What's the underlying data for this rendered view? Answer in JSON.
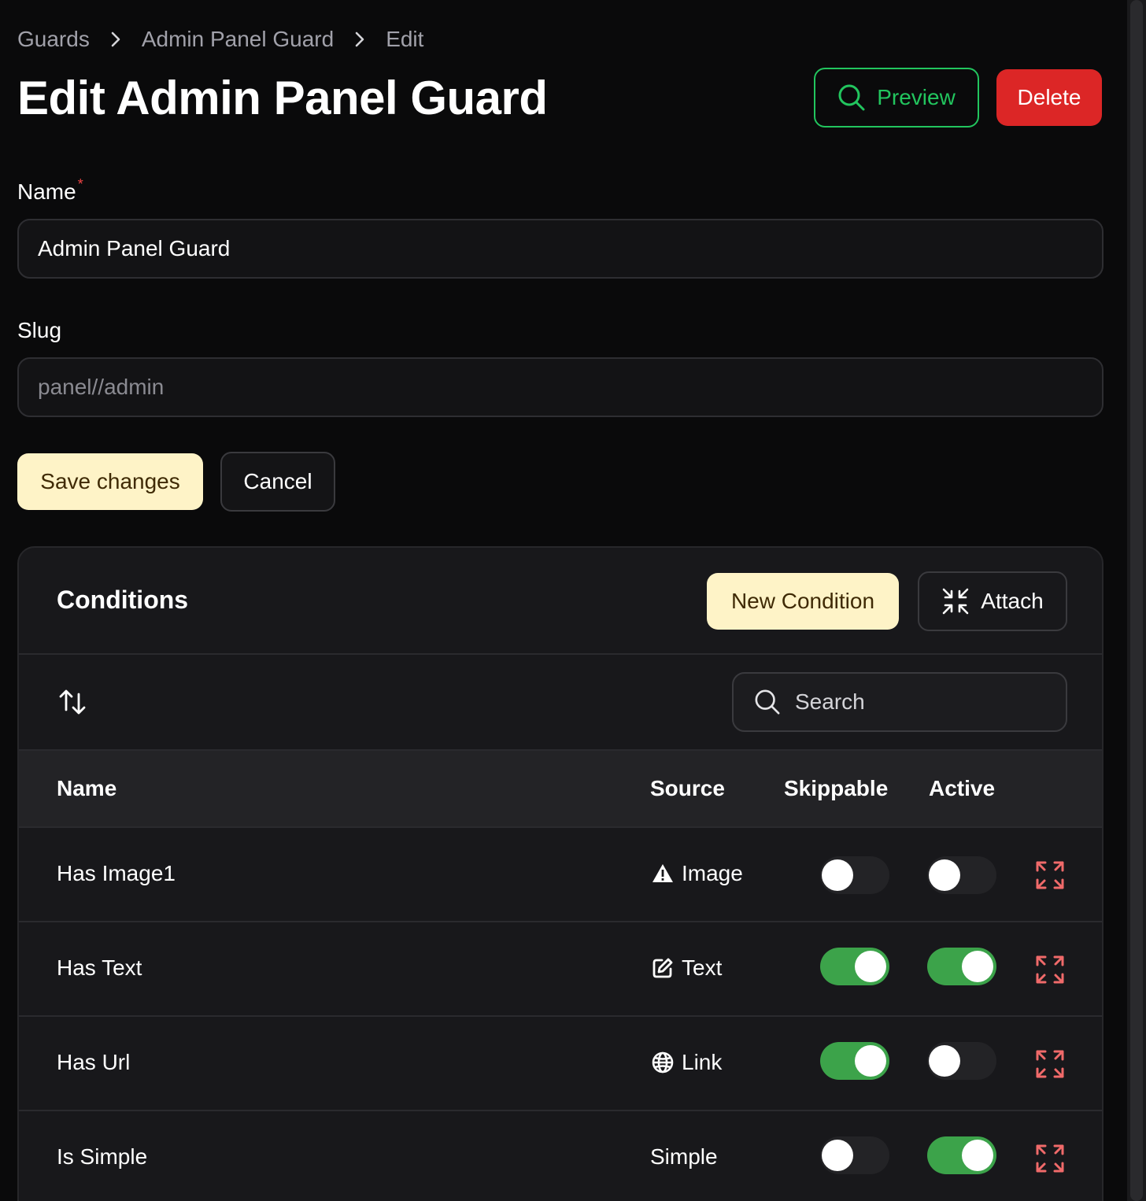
{
  "breadcrumb": [
    "Guards",
    "Admin Panel Guard",
    "Edit"
  ],
  "page_title": "Edit Admin Panel Guard",
  "actions": {
    "preview": "Preview",
    "delete": "Delete"
  },
  "form": {
    "name_label": "Name",
    "name_required_mark": "*",
    "name_value": "Admin Panel Guard",
    "slug_label": "Slug",
    "slug_placeholder": "panel//admin",
    "save_label": "Save changes",
    "cancel_label": "Cancel"
  },
  "conditions": {
    "title": "Conditions",
    "new_label": "New Condition",
    "attach_label": "Attach",
    "search_placeholder": "Search",
    "columns": {
      "name": "Name",
      "source": "Source",
      "skippable": "Skippable",
      "active": "Active"
    },
    "rows": [
      {
        "name": "Has Image1",
        "source": "Image",
        "source_icon": "warning-icon",
        "skippable": false,
        "active": false
      },
      {
        "name": "Has Text",
        "source": "Text",
        "source_icon": "edit-icon",
        "skippable": true,
        "active": true
      },
      {
        "name": "Has Url",
        "source": "Link",
        "source_icon": "globe-icon",
        "skippable": true,
        "active": false
      },
      {
        "name": "Is Simple",
        "source": "Simple",
        "source_icon": "",
        "skippable": false,
        "active": true
      }
    ]
  },
  "colors": {
    "accent_green": "#22c55e",
    "danger_red": "#dc2626",
    "primary_cream": "#fef3c7",
    "toggle_on": "#3ca34a",
    "expand_icon": "#f06a6a"
  }
}
